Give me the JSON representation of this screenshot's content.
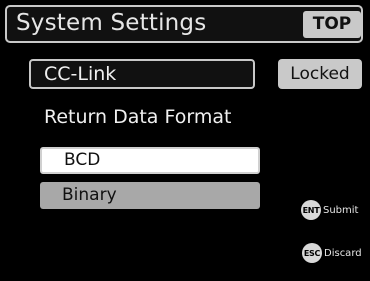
{
  "header": {
    "title": "System Settings",
    "top_button": "TOP"
  },
  "cc_link": {
    "label": "CC-Link",
    "status": "Locked"
  },
  "return_data_format": {
    "heading": "Return Data Format",
    "options": [
      {
        "label": "BCD",
        "selected": true
      },
      {
        "label": "Binary",
        "selected": false
      }
    ]
  },
  "softkeys": {
    "submit": {
      "key": "ENT",
      "label": "Submit"
    },
    "discard": {
      "key": "ESC",
      "label": "Discard"
    }
  },
  "colors": {
    "background": "#000000",
    "panel_border": "#c8c8c8",
    "highlight": "#ffffff",
    "unselected": "#a8a8a8",
    "button_gray": "#c9c9c9"
  }
}
